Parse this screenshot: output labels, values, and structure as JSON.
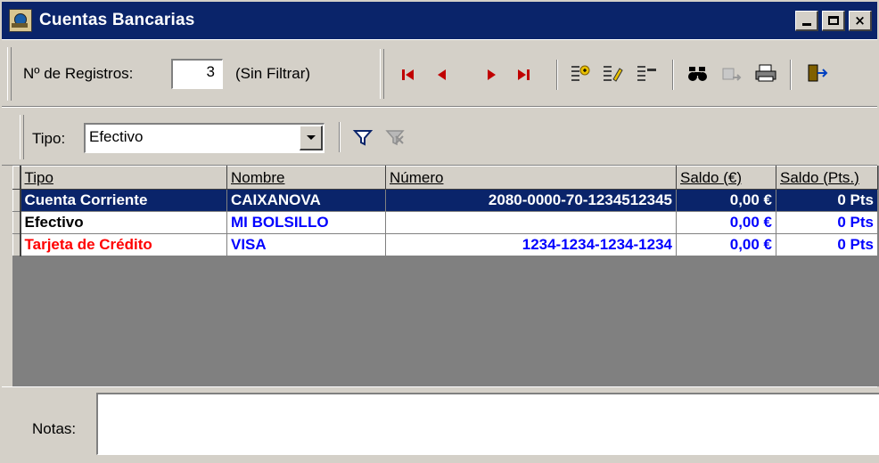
{
  "window": {
    "title": "Cuentas Bancarias",
    "minimize": "",
    "maximize": "",
    "close": "×"
  },
  "toolbar": {
    "registros_label": "Nº de Registros:",
    "registros_value": "3",
    "filter_status": "(Sin Filtrar)",
    "icons": [
      "first-record-icon",
      "prev-record-icon",
      "next-record-icon",
      "last-record-icon",
      "new-record-icon",
      "edit-record-icon",
      "delete-record-icon",
      "find-icon",
      "export-icon",
      "print-icon",
      "exit-icon"
    ]
  },
  "filter_bar": {
    "tipo_label": "Tipo:",
    "tipo_value": "Efectivo",
    "icons": [
      "filter-icon",
      "clear-filter-icon"
    ]
  },
  "grid": {
    "columns": [
      "Tipo",
      "Nombre",
      "Número",
      "Saldo (€)",
      "Saldo (Pts.)"
    ],
    "rows": [
      {
        "tipo": "Cuenta Corriente",
        "nombre": "CAIXANOVA",
        "numero": "2080-0000-70-1234512345",
        "saldo_eur": "0,00 €",
        "saldo_pts": "0 Pts",
        "tipo_color": "#ffffff",
        "selected": true
      },
      {
        "tipo": "Efectivo",
        "nombre": "MI BOLSILLO",
        "numero": "",
        "saldo_eur": "0,00 €",
        "saldo_pts": "0 Pts",
        "tipo_color": "#000000",
        "selected": false
      },
      {
        "tipo": "Tarjeta de Crédito",
        "nombre": "VISA",
        "numero": "1234-1234-1234-1234",
        "saldo_eur": "0,00 €",
        "saldo_pts": "0 Pts",
        "tipo_color": "#ff0000",
        "selected": false
      }
    ]
  },
  "notes": {
    "label": "Notas:",
    "value": ""
  },
  "colors": {
    "titlebar": "#0a246a",
    "selection": "#0a246a",
    "link_blue": "#0000ff",
    "red": "#ff0000",
    "face": "#d4d0c8"
  }
}
